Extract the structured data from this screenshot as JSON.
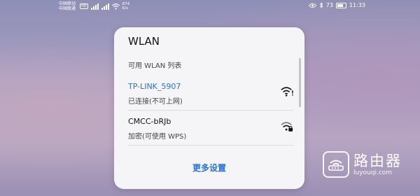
{
  "status_bar": {
    "carrier1": "中国移动",
    "carrier2": "中国联通",
    "hd_badge": "HD",
    "speed_value": "874",
    "speed_unit": "K/s",
    "battery_percent": "73",
    "battery_level": 0.73,
    "time": "11:33"
  },
  "wlan_panel": {
    "title": "WLAN",
    "section_label": "可用 WLAN 列表",
    "networks": [
      {
        "name": "TP-LINK_5907",
        "status": "已连接(不可上网)",
        "icon": "wifi-warning-icon"
      },
      {
        "name": "CMCC-bRJb",
        "status": "加密(可使用 WPS)",
        "icon": "wifi-lock-icon"
      }
    ],
    "more_settings": "更多设置"
  },
  "watermark": {
    "name": "路由器",
    "url": "luyouqi.com"
  },
  "colors": {
    "accent_blue": "#2a72d8",
    "panel_bg": "#f5f5f7"
  }
}
